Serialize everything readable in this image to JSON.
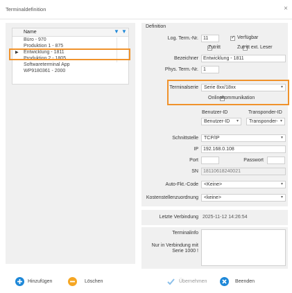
{
  "window": {
    "title": "Terminaldefinition",
    "close_glyph": "×"
  },
  "terminal_list": {
    "column_name": "Name",
    "rows": [
      "Büro - 970",
      "Produktion 1 - 875",
      "Entwicklung - 1811",
      "Produktion 2 - 1805",
      "Softwareterminal App",
      "WP9180361 - 2000"
    ],
    "selected_row": "Entwicklung - 1811",
    "pointer_glyph": "▶"
  },
  "definition": {
    "section_label": "Definition",
    "log_term_nr_label": "Log. Term.-Nr.",
    "log_term_nr_value": "11",
    "verfuegbar_label": "Verfügbar",
    "zutritt_label": "Zutritt",
    "zutritt_ext_label": "Zutritt ext. Leser",
    "bezeichner_label": "Bezeichner",
    "bezeichner_value": "Entwicklung - 1811",
    "phys_term_nr_label": "Phys. Term.-Nr.",
    "phys_term_nr_value": "1",
    "terminalserie_label": "Terminalserie",
    "terminalserie_value": "Serie 8xx/18xx",
    "onlinekommunikation_label": "Onlinekommunikation",
    "benutzer_id_header": "Benutzer-ID",
    "benutzer_id_value": "Benutzer-ID",
    "transponder_id_header": "Transponder-ID",
    "transponder_id_value": "Transponder-",
    "schnittstelle_label": "Schnittstelle",
    "schnittstelle_value": "TCP/IP",
    "ip_label": "IP",
    "ip_value": "192.168.0.108",
    "port_label": "Port",
    "port_value": "",
    "passwort_label": "Passwort",
    "passwort_value": "",
    "sn_label": "SN",
    "sn_value": "18110618240021",
    "auto_fkt_label": "Auto-Fkt.-Code",
    "auto_fkt_value": "<Keine>",
    "kostenstellen_label": "Kostenstellenzuordnung",
    "kostenstellen_value": "<keine>"
  },
  "connection": {
    "label": "Letzte Verbindung",
    "value": "2025-11-12 14:26:54"
  },
  "terminalinfo": {
    "label": "Terminalinfo",
    "note": "Nur in Verbindung mit Serie 1000 !"
  },
  "footer": {
    "add_label": "Hinzufügen",
    "delete_label": "Löschen",
    "apply_label": "Übernehmen",
    "exit_label": "Beenden"
  },
  "colors": {
    "highlight": "#f0922b",
    "accent_blue": "#1e88d8",
    "delete_orange": "#f5a623"
  }
}
